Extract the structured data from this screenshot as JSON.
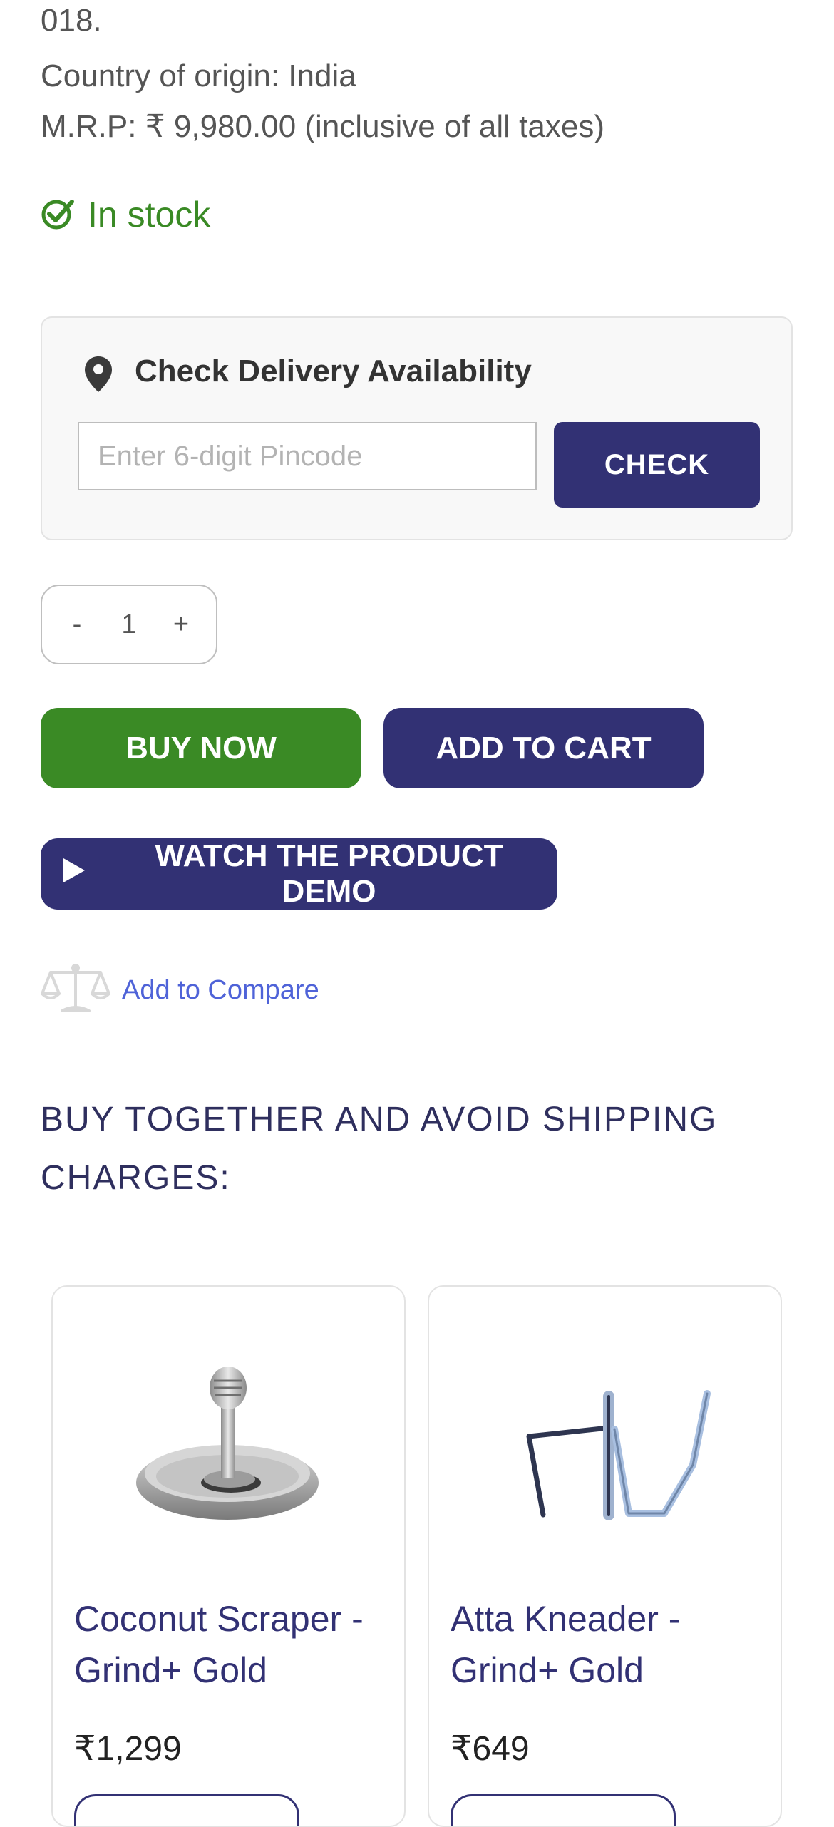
{
  "product_info": {
    "address_tail": "018.",
    "country_of_origin": "Country of origin: India",
    "mrp": "M.R.P: ₹ 9,980.00 (inclusive of all taxes)"
  },
  "stock": {
    "label": "In stock",
    "icon": "check-circle-icon",
    "color": "#3a8a25"
  },
  "delivery": {
    "title": "Check Delivery Availability",
    "icon": "location-pin-icon",
    "pincode_placeholder": "Enter 6-digit Pincode",
    "pincode_value": "",
    "check_label": "CHECK"
  },
  "quantity": {
    "minus": "-",
    "value": "1",
    "plus": "+"
  },
  "actions": {
    "buy_now": "BUY NOW",
    "add_to_cart": "ADD TO CART",
    "watch_demo": "WATCH THE PRODUCT DEMO",
    "compare": "Add to Compare"
  },
  "bundle": {
    "heading": "BUY TOGETHER AND AVOID SHIPPING CHARGES:",
    "products": [
      {
        "title": "Coconut Scraper - Grind+ Gold",
        "price": "₹1,299",
        "image": "coconut-scraper-image"
      },
      {
        "title": "Atta Kneader - Grind+ Gold",
        "price": "₹649",
        "image": "atta-kneader-image"
      }
    ]
  },
  "colors": {
    "primary": "#323174",
    "success": "#3a8a25",
    "link": "#4f63d8"
  }
}
